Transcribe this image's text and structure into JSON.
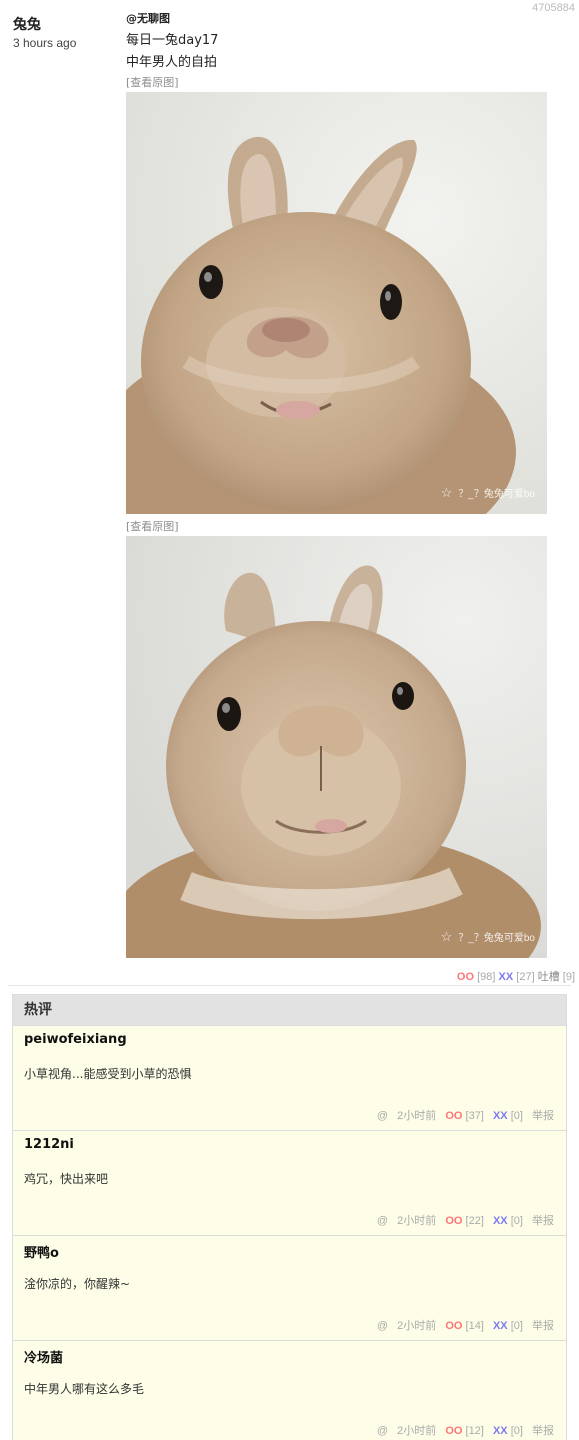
{
  "post": {
    "id": "4705884",
    "author": "兔兔",
    "time": "3 hours ago",
    "mention": "@无聊图",
    "lines": [
      "每日一兔day17",
      "中年男人的自拍"
    ],
    "view_original_label": "[查看原图]",
    "images": [
      {
        "subject": "rabbit-selfie-close-up",
        "watermark": "？_？兔兔可爱bo"
      },
      {
        "subject": "rabbit-selfie-low-angle",
        "watermark": "？_？兔兔可爱bo"
      }
    ],
    "votes": {
      "oo_label": "OO",
      "oo_count": "[98]",
      "xx_label": "XX",
      "xx_count": "[27]",
      "tucao_label": "吐槽",
      "tucao_count": "[9]"
    }
  },
  "hot_comments": {
    "title": "热评",
    "items": [
      {
        "author": "peiwofeixiang",
        "text": "小草视角...能感受到小草的恐惧",
        "at": "@",
        "time": "2小时前",
        "oo_label": "OO",
        "oo_count": "[37]",
        "xx_label": "XX",
        "xx_count": "[0]",
        "report": "举报"
      },
      {
        "author": "1212ni",
        "text": "鸡冗，快出来吧",
        "at": "@",
        "time": "2小时前",
        "oo_label": "OO",
        "oo_count": "[22]",
        "xx_label": "XX",
        "xx_count": "[0]",
        "report": "举报"
      },
      {
        "author": "野鸭o",
        "text": "淦你凉的，你醒辣~",
        "at": "@",
        "time": "2小时前",
        "oo_label": "OO",
        "oo_count": "[14]",
        "xx_label": "XX",
        "xx_count": "[0]",
        "report": "举报"
      },
      {
        "author": "冷场菌",
        "text": "中年男人哪有这么多毛",
        "at": "@",
        "time": "2小时前",
        "oo_label": "OO",
        "oo_count": "[12]",
        "xx_label": "XX",
        "xx_count": "[0]",
        "report": "举报"
      }
    ]
  },
  "colors": {
    "oo": "#ff7575",
    "xx": "#7b7bf0",
    "comment_bg": "#fefee8",
    "header_bg": "#e2e2e2"
  }
}
